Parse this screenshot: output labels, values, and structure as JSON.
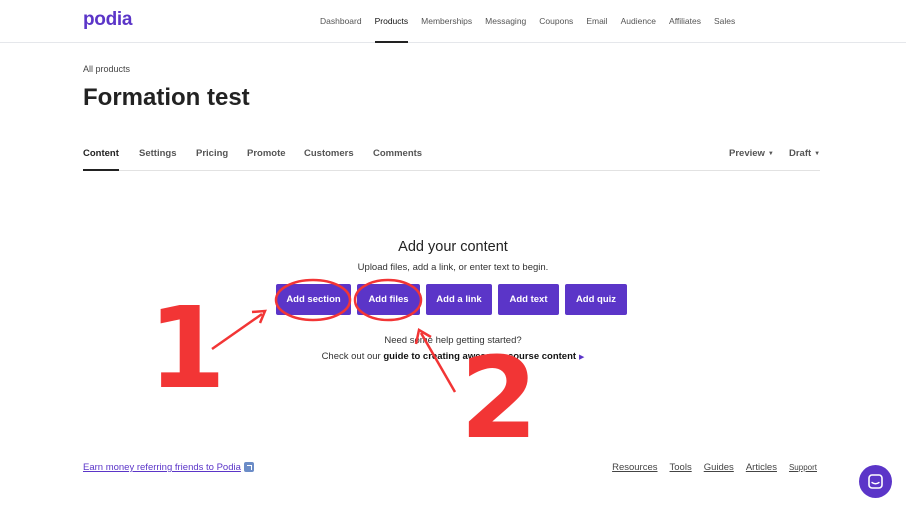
{
  "brand": {
    "logo": "podia",
    "accent": "#5b35c8"
  },
  "nav": [
    "Dashboard",
    "Products",
    "Memberships",
    "Messaging",
    "Coupons",
    "Email",
    "Audience",
    "Affiliates",
    "Sales"
  ],
  "nav_active": "Products",
  "breadcrumb": "All products",
  "page_title": "Formation test",
  "tabs": [
    "Content",
    "Settings",
    "Pricing",
    "Promote",
    "Customers",
    "Comments"
  ],
  "tab_active": "Content",
  "tab_actions": {
    "preview": "Preview",
    "status": "Draft"
  },
  "content": {
    "heading": "Add your content",
    "subheading": "Upload files, add a link, or enter text to begin.",
    "buttons": [
      "Add section",
      "Add files",
      "Add a link",
      "Add text",
      "Add quiz"
    ],
    "help": "Need some help getting started?",
    "guide_prefix": "Check out our",
    "guide_link": "guide to creating awesome course content"
  },
  "footer": {
    "referral": "Earn money referring friends to Podia",
    "links": [
      "Resources",
      "Tools",
      "Guides",
      "Articles",
      "Support"
    ]
  },
  "annotations": {
    "marker1": "1",
    "marker2": "2",
    "color": "#f23535"
  }
}
